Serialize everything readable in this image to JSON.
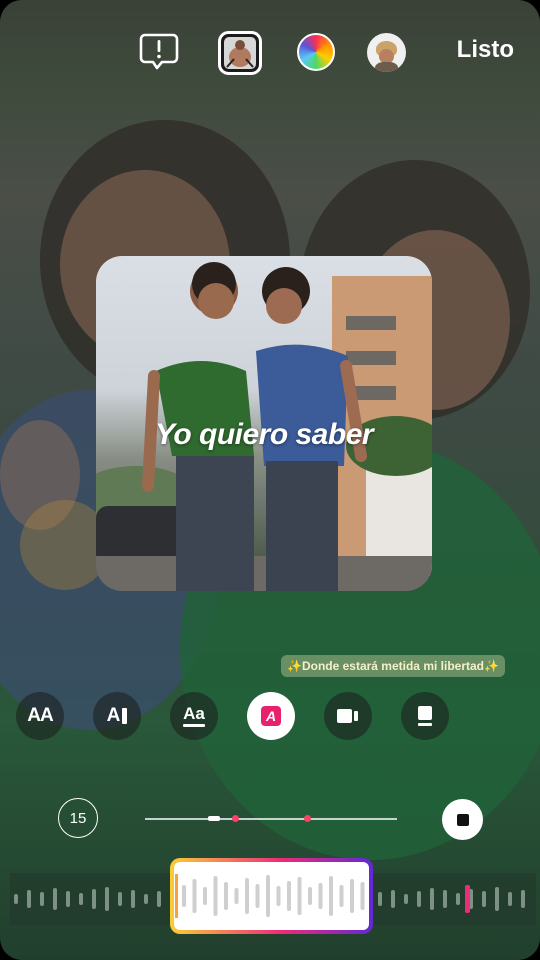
{
  "header": {
    "alert_icon": "exclamation-speech-icon",
    "sticker_icon": "photo-thumbnail-icon",
    "color_icon": "color-wheel-icon",
    "profile_icon": "avatar-icon",
    "done_label": "Listo"
  },
  "sticker": {
    "lyric_text": "Yo quiero saber"
  },
  "caption": {
    "text": "✨Donde estará metida mi libertad✨"
  },
  "toolbar": {
    "buttons": [
      {
        "icon": "text-size-aa-icon",
        "label": "AA"
      },
      {
        "icon": "text-align-icon",
        "label": "A"
      },
      {
        "icon": "text-underline-aa-icon",
        "label": "Aa"
      },
      {
        "icon": "lyrics-style-icon",
        "label": "A"
      },
      {
        "icon": "video-clip-icon",
        "label": ""
      },
      {
        "icon": "card-format-icon",
        "label": ""
      }
    ]
  },
  "playback": {
    "duration": "15",
    "stop_icon": "stop-icon",
    "playhead_fraction": 0.27
  },
  "colors": {
    "accent_pink": "#ff3f6a",
    "gradient": [
      "#f9ce34",
      "#ee2a7b",
      "#6228d7"
    ]
  }
}
